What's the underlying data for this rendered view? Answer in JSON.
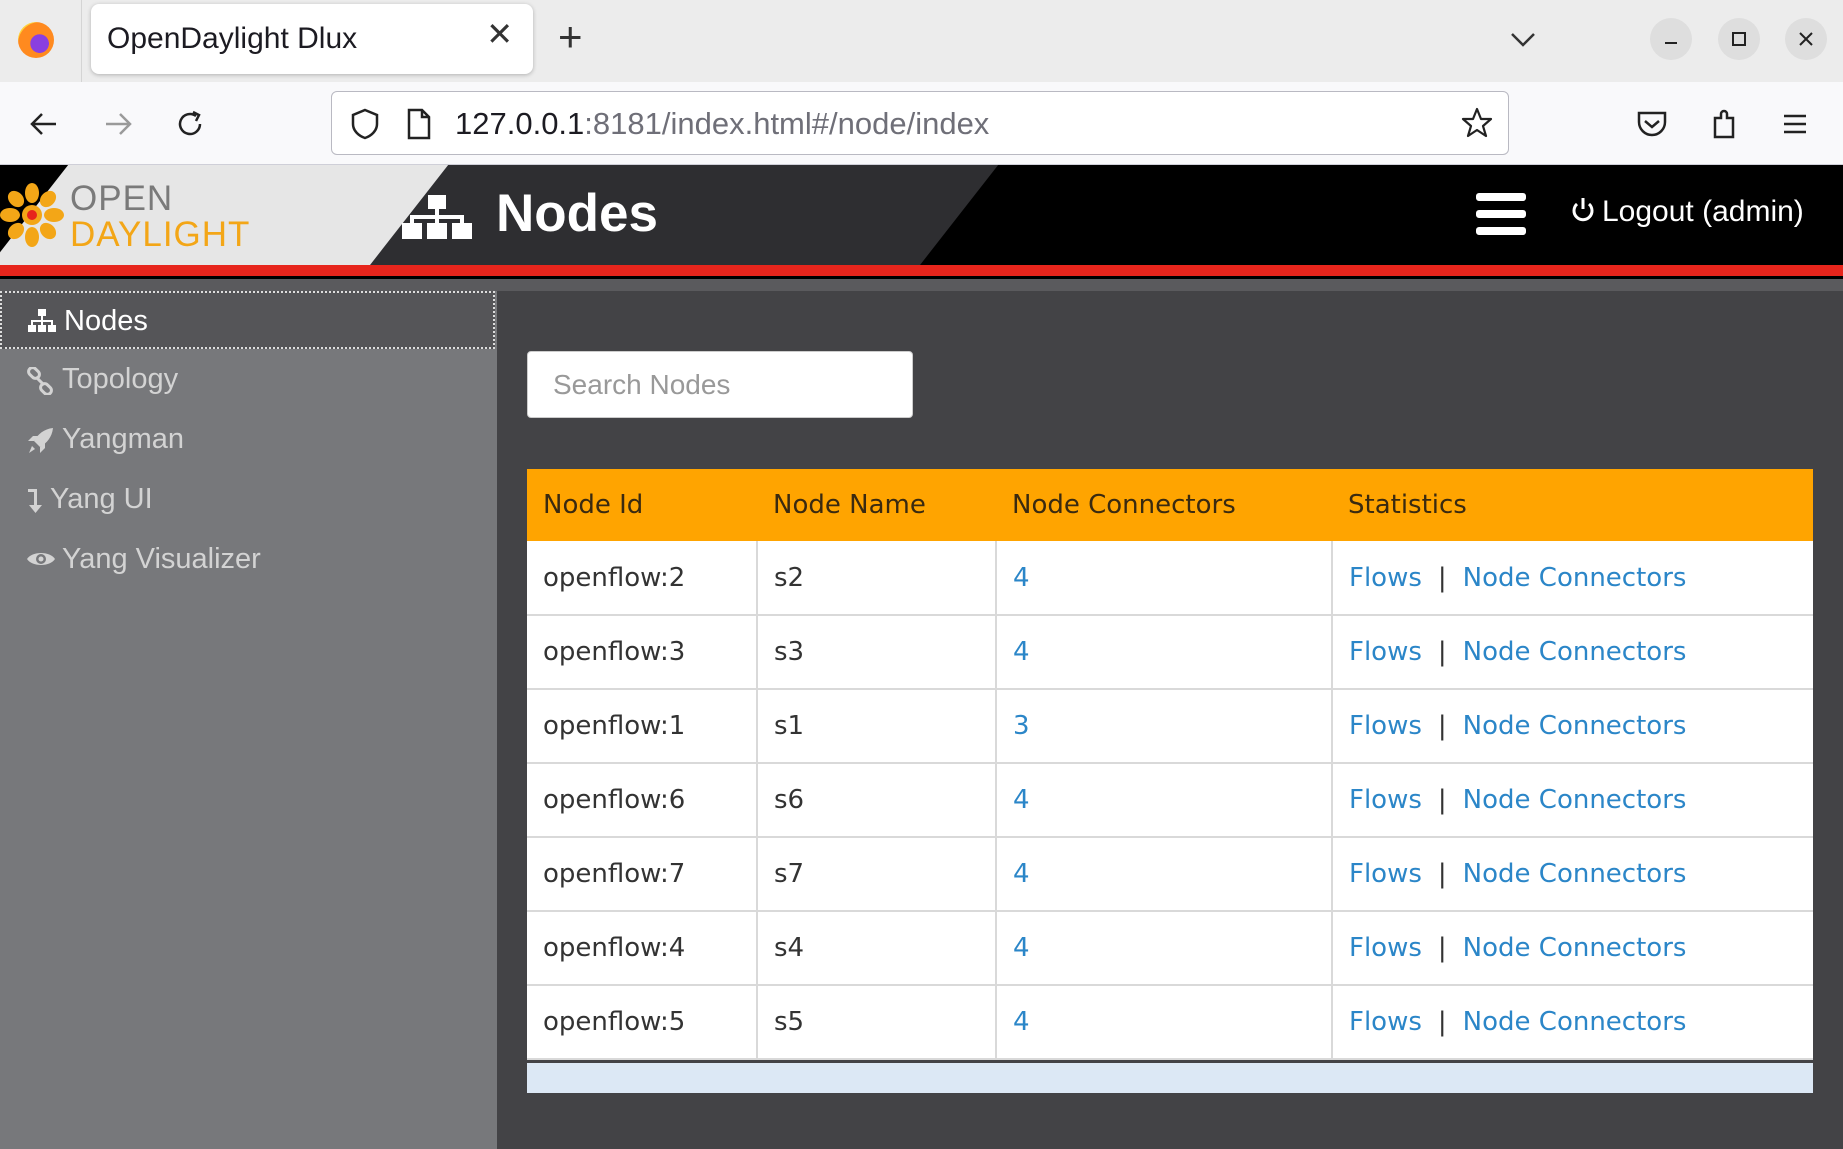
{
  "browser": {
    "tab_title": "OpenDaylight Dlux",
    "url_host": "127.0.0.1",
    "url_rest": ":8181/index.html#/node/index"
  },
  "header": {
    "logo_line1": "OPEN",
    "logo_line2": "DAYLIGHT",
    "title": "Nodes",
    "logout_label": "Logout (admin)"
  },
  "sidebar": {
    "items": [
      {
        "label": "Nodes",
        "icon": "sitemap-icon"
      },
      {
        "label": "Topology",
        "icon": "link-icon"
      },
      {
        "label": "Yangman",
        "icon": "rocket-icon"
      },
      {
        "label": "Yang UI",
        "icon": "level-down-icon"
      },
      {
        "label": "Yang Visualizer",
        "icon": "eye-icon"
      }
    ]
  },
  "search": {
    "placeholder": "Search Nodes"
  },
  "table": {
    "columns": [
      "Node Id",
      "Node Name",
      "Node Connectors",
      "Statistics"
    ],
    "flows_label": "Flows",
    "connectors_label": "Node Connectors",
    "rows": [
      {
        "id": "openflow:2",
        "name": "s2",
        "connectors": "4"
      },
      {
        "id": "openflow:3",
        "name": "s3",
        "connectors": "4"
      },
      {
        "id": "openflow:1",
        "name": "s1",
        "connectors": "3"
      },
      {
        "id": "openflow:6",
        "name": "s6",
        "connectors": "4"
      },
      {
        "id": "openflow:7",
        "name": "s7",
        "connectors": "4"
      },
      {
        "id": "openflow:4",
        "name": "s4",
        "connectors": "4"
      },
      {
        "id": "openflow:5",
        "name": "s5",
        "connectors": "4"
      }
    ]
  },
  "colors": {
    "header_accent": "#ffa400",
    "link": "#2b86c8",
    "red_bar": "#e7251c",
    "logo_orange": "#f3a617"
  }
}
